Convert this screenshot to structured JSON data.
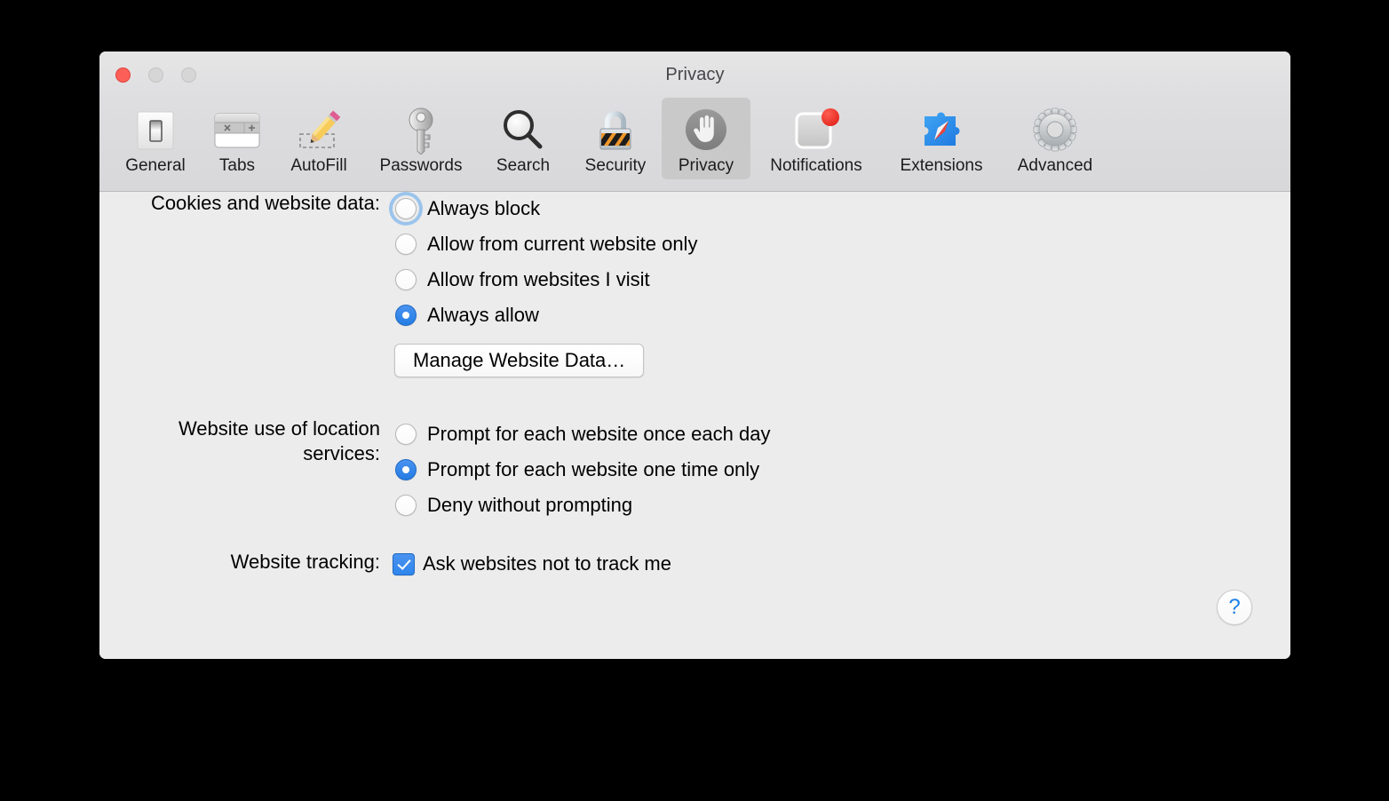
{
  "window": {
    "title": "Privacy",
    "traffic_lights": [
      {
        "name": "close",
        "color": "#fc5f57"
      },
      {
        "name": "minimize",
        "color": "#d6d6d6"
      },
      {
        "name": "zoom",
        "color": "#d6d6d6"
      }
    ]
  },
  "toolbar": {
    "selected": "Privacy",
    "items": [
      {
        "label": "General",
        "icon": "general-switch-icon"
      },
      {
        "label": "Tabs",
        "icon": "tabs-window-icon"
      },
      {
        "label": "AutoFill",
        "icon": "autofill-pencil-icon"
      },
      {
        "label": "Passwords",
        "icon": "passwords-key-icon"
      },
      {
        "label": "Search",
        "icon": "search-magnifier-icon"
      },
      {
        "label": "Security",
        "icon": "security-padlock-icon"
      },
      {
        "label": "Privacy",
        "icon": "privacy-hand-icon"
      },
      {
        "label": "Notifications",
        "icon": "notifications-badge-icon"
      },
      {
        "label": "Extensions",
        "icon": "extensions-puzzle-icon"
      },
      {
        "label": "Advanced",
        "icon": "advanced-gear-icon"
      }
    ]
  },
  "sections": {
    "cookies": {
      "label": "Cookies and website data:",
      "options": [
        {
          "text": "Always block",
          "selected": false,
          "focused": true
        },
        {
          "text": "Allow from current website only",
          "selected": false,
          "focused": false
        },
        {
          "text": "Allow from websites I visit",
          "selected": false,
          "focused": false
        },
        {
          "text": "Always allow",
          "selected": true,
          "focused": false
        }
      ],
      "button": "Manage Website Data…"
    },
    "location": {
      "label": "Website use of location services:",
      "options": [
        {
          "text": "Prompt for each website once each day",
          "selected": false,
          "focused": false
        },
        {
          "text": "Prompt for each website one time only",
          "selected": true,
          "focused": false
        },
        {
          "text": "Deny without prompting",
          "selected": false,
          "focused": false
        }
      ]
    },
    "tracking": {
      "label": "Website tracking:",
      "checkbox_text": "Ask websites not to track me",
      "checked": true
    }
  },
  "help": {
    "glyph": "?"
  },
  "colors": {
    "accent_blue": "#2f86ec",
    "focus_ring": "#9bc4ec",
    "window_bg": "#ececec",
    "toolbar_bg": "#dedee0",
    "selected_tab_bg": "#c9c9c9",
    "close_red": "#fc5f57",
    "help_blue": "#1b7fe8"
  }
}
